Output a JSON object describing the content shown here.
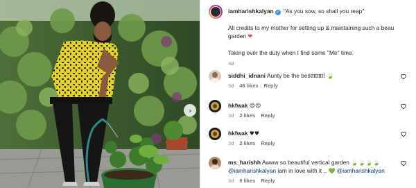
{
  "post": {
    "author": "iamharishkalyan",
    "caption_line1": "\"As you sow, so shall you reap\"",
    "caption_line2": "All credits to my mother for setting up & maintaining such a beau garden",
    "caption_emoji": "❤",
    "caption_line3": "Taking over the duty when I find some \"Me\" time.",
    "time": "3d"
  },
  "comments": [
    {
      "user": "siddhi_idnani",
      "text": "Aunty be the bestttttttt! 🍃",
      "time": "3d",
      "likes": "46 likes",
      "reply": "Reply"
    },
    {
      "user": "hkfwak",
      "text": "😍😍",
      "time": "3d",
      "likes": "2 likes",
      "reply": "Reply"
    },
    {
      "user": "hkfwak",
      "text": "♥♥",
      "time": "3d",
      "likes": "2 likes",
      "reply": "Reply"
    },
    {
      "user": "ms_harishh",
      "text_a": "Awww so beautiful vertical garden 🍃🍃🍃🍃",
      "mention1": "@iamharishkalyan",
      "text_b": " iam in love with it .. ",
      "heart": "💚",
      "mention2": "@iamharishkalyan",
      "time": "3d",
      "likes": "6 likes",
      "reply": "Reply"
    }
  ],
  "icons": {
    "like": "heart-outline-icon",
    "next": "chevron-right-icon",
    "verified": "verified-badge-icon"
  },
  "colors": {
    "verified": "#3897f0",
    "emoji_heart": "#ed4956",
    "meta": "#8e8e8e",
    "mention": "#00376b"
  }
}
